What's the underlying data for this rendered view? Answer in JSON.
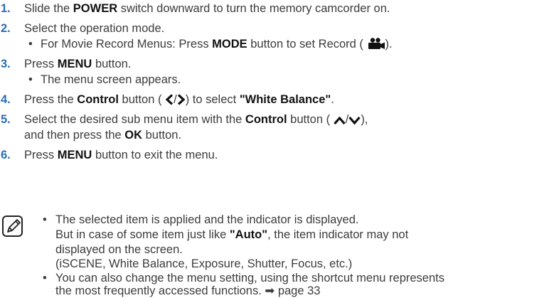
{
  "steps": [
    {
      "num": "1.",
      "pre": "Slide the ",
      "b1": "POWER",
      "post": " switch downward to turn the memory camcorder on."
    },
    {
      "num": "2.",
      "text": "Select the operation mode."
    },
    {
      "num": "3.",
      "pre": "Press ",
      "b1": "MENU",
      "post": " button."
    },
    {
      "num": "4.",
      "pre": "Press the ",
      "b1": "Control",
      "mid": " button (",
      "sep": "/",
      "mid2": ") to select ",
      "b2": "\"White Balance\"",
      "post": "."
    },
    {
      "num": "5.",
      "pre": "Select the desired sub menu item with the ",
      "b1": "Control",
      "mid": " button (",
      "sep": "/",
      "post": "),",
      "line2_pre": "and then press the ",
      "line2_b": "OK",
      "line2_post": " button."
    },
    {
      "num": "6.",
      "pre": "Press ",
      "b1": "MENU",
      "post": " button to exit the menu."
    }
  ],
  "sub_bullets": {
    "step2": {
      "pre": "For Movie Record Menus: Press ",
      "b": "MODE",
      "mid": " button to set Record (",
      "post": ")."
    },
    "step3": {
      "text": "The menu screen appears."
    }
  },
  "note": {
    "bullet1": {
      "line1": "The selected item is applied and the indicator is displayed.",
      "line2_pre": "But in case of some item just like ",
      "line2_b": "\"Auto\"",
      "line2_post": ", the item indicator may not",
      "line3": "displayed on the screen.",
      "line4": "(iSCENE, White Balance, Exposure, Shutter, Focus, etc.)"
    },
    "bullet2": {
      "line1": "You can also change the menu setting, using the shortcut menu represents",
      "line2": "the most frequently accessed functions. ➡ page 33"
    }
  },
  "bullet_char": "•",
  "icons": [
    "movie-camera-icon",
    "chevron-left-icon",
    "chevron-right-icon",
    "chevron-up-icon",
    "chevron-down-icon",
    "note-pencil-icon"
  ],
  "colors": {
    "step_number": "#2a6db5",
    "text": "#3c3c3c",
    "bold": "#111111"
  }
}
